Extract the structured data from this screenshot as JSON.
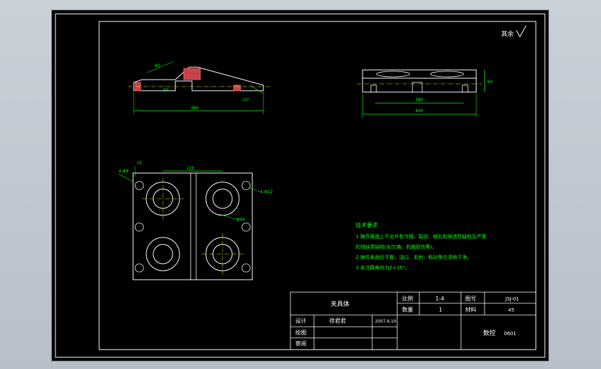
{
  "drawing": {
    "roughness_note": "其余",
    "tech_req": {
      "title": "技术要求",
      "lines": [
        "1 铸件表面上不允许有冷隔、裂纹、缩孔和穿透性缺陷及严重",
        "的残缺类缺陷(如欠铸、机械损伤等)。",
        "2 铸件表面应平整，浇口、毛刺、粘砂等应清除干净。",
        "3 未注圆角均为2×15°。"
      ]
    },
    "title_block": {
      "part_name": "夹具体",
      "scale_label": "比例",
      "scale_value": "1:4",
      "drawing_no_label": "图号",
      "drawing_no_value": "JSJ-01",
      "qty_label": "数量",
      "qty_value": "1",
      "material_label": "材料",
      "material_value": "45",
      "design_label": "设计",
      "designer": "徐君君",
      "design_date": "2007.6.10",
      "draw_label": "绘图",
      "review_label": "审阅",
      "school": "数控",
      "class": "0601"
    },
    "dims": {
      "front_total": "380",
      "front_angle": "15°",
      "front_a": "40",
      "front_b": "20",
      "top_len": "120",
      "top_hole_left": "4-Φ8",
      "top_hole_right": "4-Φ12",
      "top_offset": "15",
      "top_bore": "Φ40",
      "side_width": "380",
      "side_total": "400",
      "side_height": "60"
    }
  }
}
